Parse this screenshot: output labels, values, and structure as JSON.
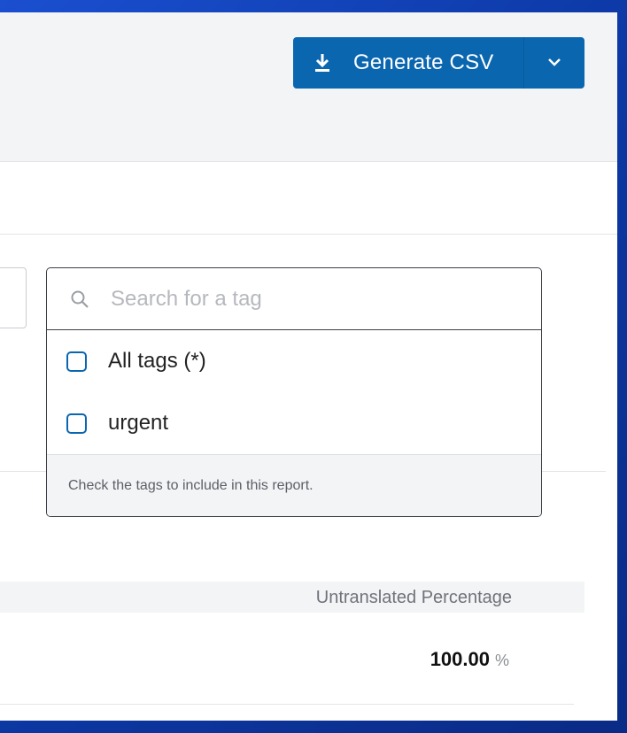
{
  "toolbar": {
    "generate_label": "Generate CSV",
    "download_icon": "download-icon",
    "caret_icon": "chevron-down-icon",
    "accent": "#0b66b0"
  },
  "tag_dropdown": {
    "search_placeholder": "Search for a tag",
    "search_value": "",
    "options": [
      {
        "label": "All tags (*)",
        "checked": false
      },
      {
        "label": "urgent",
        "checked": false
      }
    ],
    "hint": "Check the tags to include in this report."
  },
  "table": {
    "header": "Untranslated Percentage",
    "value": "100.00",
    "unit": "%"
  }
}
